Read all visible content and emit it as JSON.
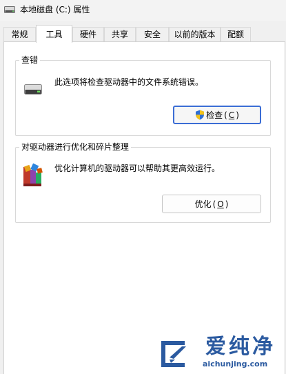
{
  "window": {
    "title": "本地磁盘 (C:) 属性",
    "icon": "drive-icon"
  },
  "tabs": [
    {
      "label": "常规",
      "active": false
    },
    {
      "label": "工具",
      "active": true
    },
    {
      "label": "硬件",
      "active": false
    },
    {
      "label": "共享",
      "active": false
    },
    {
      "label": "安全",
      "active": false
    },
    {
      "label": "以前的版本",
      "active": false
    },
    {
      "label": "配额",
      "active": false
    }
  ],
  "error_check": {
    "title": "查错",
    "icon": "hard-drive-icon",
    "description": "此选项将检查驱动器中的文件系统错误。",
    "button_label": "检查",
    "button_accel": "C",
    "button_icon": "uac-shield-icon"
  },
  "optimize": {
    "title": "对驱动器进行优化和碎片整理",
    "icon": "defrag-icon",
    "description": "优化计算机的驱动器可以帮助其更高效运行。",
    "button_label": "优化",
    "button_accel": "O"
  },
  "watermark": {
    "brand": "爱纯净",
    "url": "aichunjing.com",
    "color": "#2b5aa0"
  }
}
